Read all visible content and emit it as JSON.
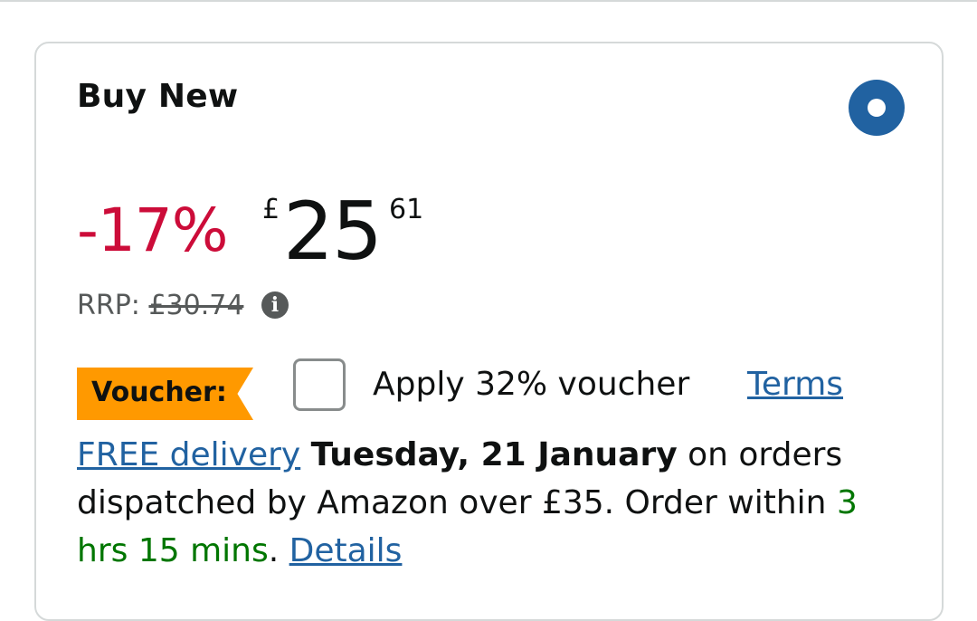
{
  "card": {
    "title": "Buy New",
    "selected": true
  },
  "price": {
    "discount": "-17%",
    "currency_symbol": "£",
    "whole": "25",
    "fraction": "61"
  },
  "rrp": {
    "label": "RRP:",
    "value": "£30.74",
    "info_icon": "info-icon"
  },
  "voucher": {
    "badge": "Voucher:",
    "checked": false,
    "apply_text": "Apply 32% voucher",
    "terms_link": "Terms"
  },
  "delivery": {
    "free_delivery_link": "FREE delivery",
    "date": "Tuesday, 21 January",
    "condition": "on orders dispatched by Amazon over £35. Order within",
    "countdown": "3 hrs 15 mins",
    "period": ".",
    "details_link": "Details"
  },
  "colors": {
    "discount": "#cc0c39",
    "link": "#2162a1",
    "voucher_badge": "#ff9900",
    "countdown": "#007600",
    "radio": "#2162a1"
  }
}
